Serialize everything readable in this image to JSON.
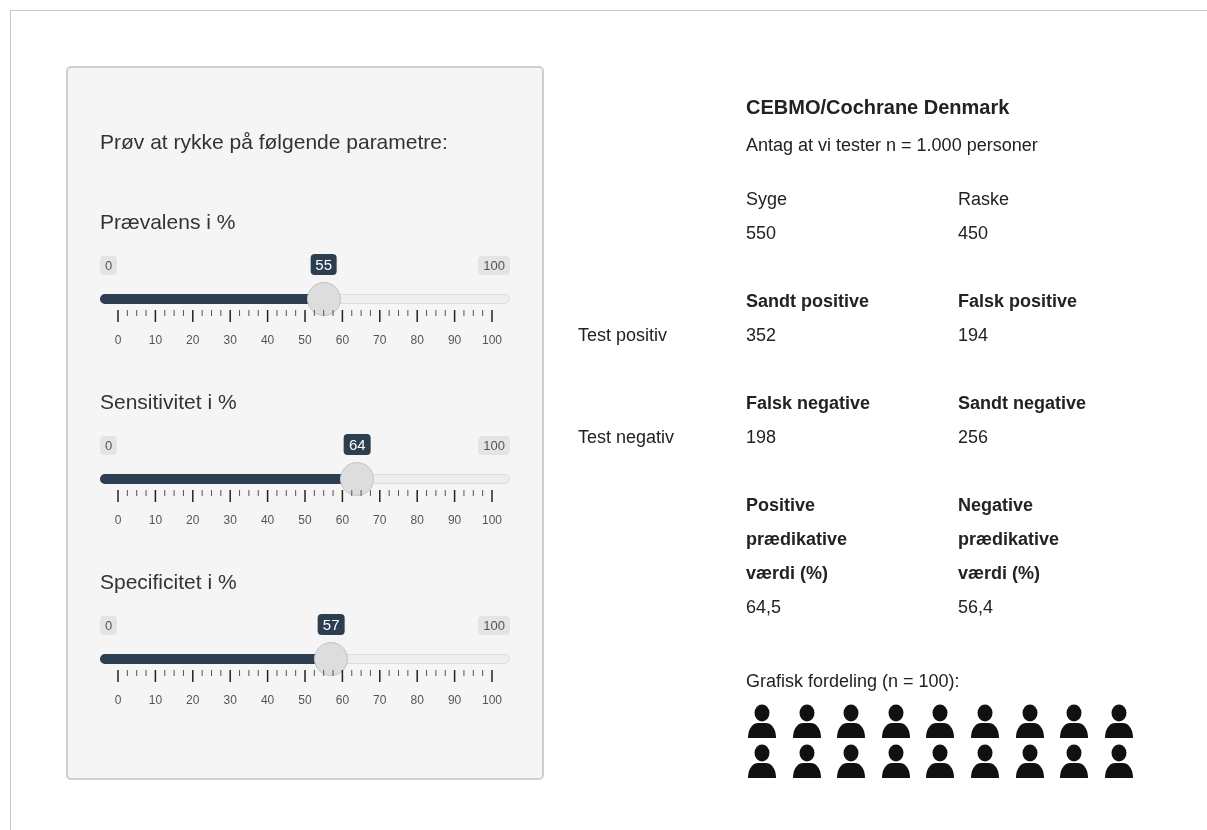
{
  "controls": {
    "heading": "Prøv at rykke på følgende parametre:",
    "sliders": [
      {
        "label": "Prævalens i %",
        "min": "0",
        "max": "100",
        "value": "55",
        "level": 0.55,
        "ticks": [
          "0",
          "10",
          "20",
          "30",
          "40",
          "50",
          "60",
          "70",
          "80",
          "90",
          "100"
        ]
      },
      {
        "label": "Sensitivitet i %",
        "min": "0",
        "max": "100",
        "value": "64",
        "level": 0.64,
        "ticks": [
          "0",
          "10",
          "20",
          "30",
          "40",
          "50",
          "60",
          "70",
          "80",
          "90",
          "100"
        ]
      },
      {
        "label": "Specificitet i %",
        "min": "0",
        "max": "100",
        "value": "57",
        "level": 0.57,
        "ticks": [
          "0",
          "10",
          "20",
          "30",
          "40",
          "50",
          "60",
          "70",
          "80",
          "90",
          "100"
        ]
      }
    ]
  },
  "results": {
    "title": "CEBMO/Cochrane Denmark",
    "subtitle": "Antag at vi tester n = 1.000 personer",
    "rows": [
      {
        "kind": "population",
        "cells": [
          {
            "heading": "Syge",
            "value": "550"
          },
          {
            "heading": "Raske",
            "value": "450"
          }
        ]
      },
      {
        "kind": "test",
        "label": "Test positiv",
        "cells": [
          {
            "heading": "Sandt positive",
            "value": "352"
          },
          {
            "heading": "Falsk positive",
            "value": "194"
          }
        ]
      },
      {
        "kind": "test",
        "label": "Test negativ",
        "cells": [
          {
            "heading": "Falsk negative",
            "value": "198"
          },
          {
            "heading": "Sandt negative",
            "value": "256"
          }
        ]
      },
      {
        "kind": "predictive",
        "cells": [
          {
            "heading": "Positive prædikative værdi (%)",
            "value": "64,5"
          },
          {
            "heading": "Negative prædikative værdi (%)",
            "value": "56,4"
          }
        ]
      }
    ],
    "distribution": {
      "caption": "Grafisk fordeling (n = 100):",
      "people": [
        {
          "kind": "person"
        },
        {
          "kind": "person"
        },
        {
          "kind": "person"
        },
        {
          "kind": "person"
        },
        {
          "kind": "person"
        },
        {
          "kind": "person"
        },
        {
          "kind": "person"
        },
        {
          "kind": "person"
        },
        {
          "kind": "person"
        },
        {
          "kind": "person"
        },
        {
          "kind": "person"
        },
        {
          "kind": "person"
        },
        {
          "kind": "person"
        },
        {
          "kind": "person"
        },
        {
          "kind": "person"
        },
        {
          "kind": "person"
        },
        {
          "kind": "person"
        },
        {
          "kind": "person"
        }
      ]
    }
  }
}
